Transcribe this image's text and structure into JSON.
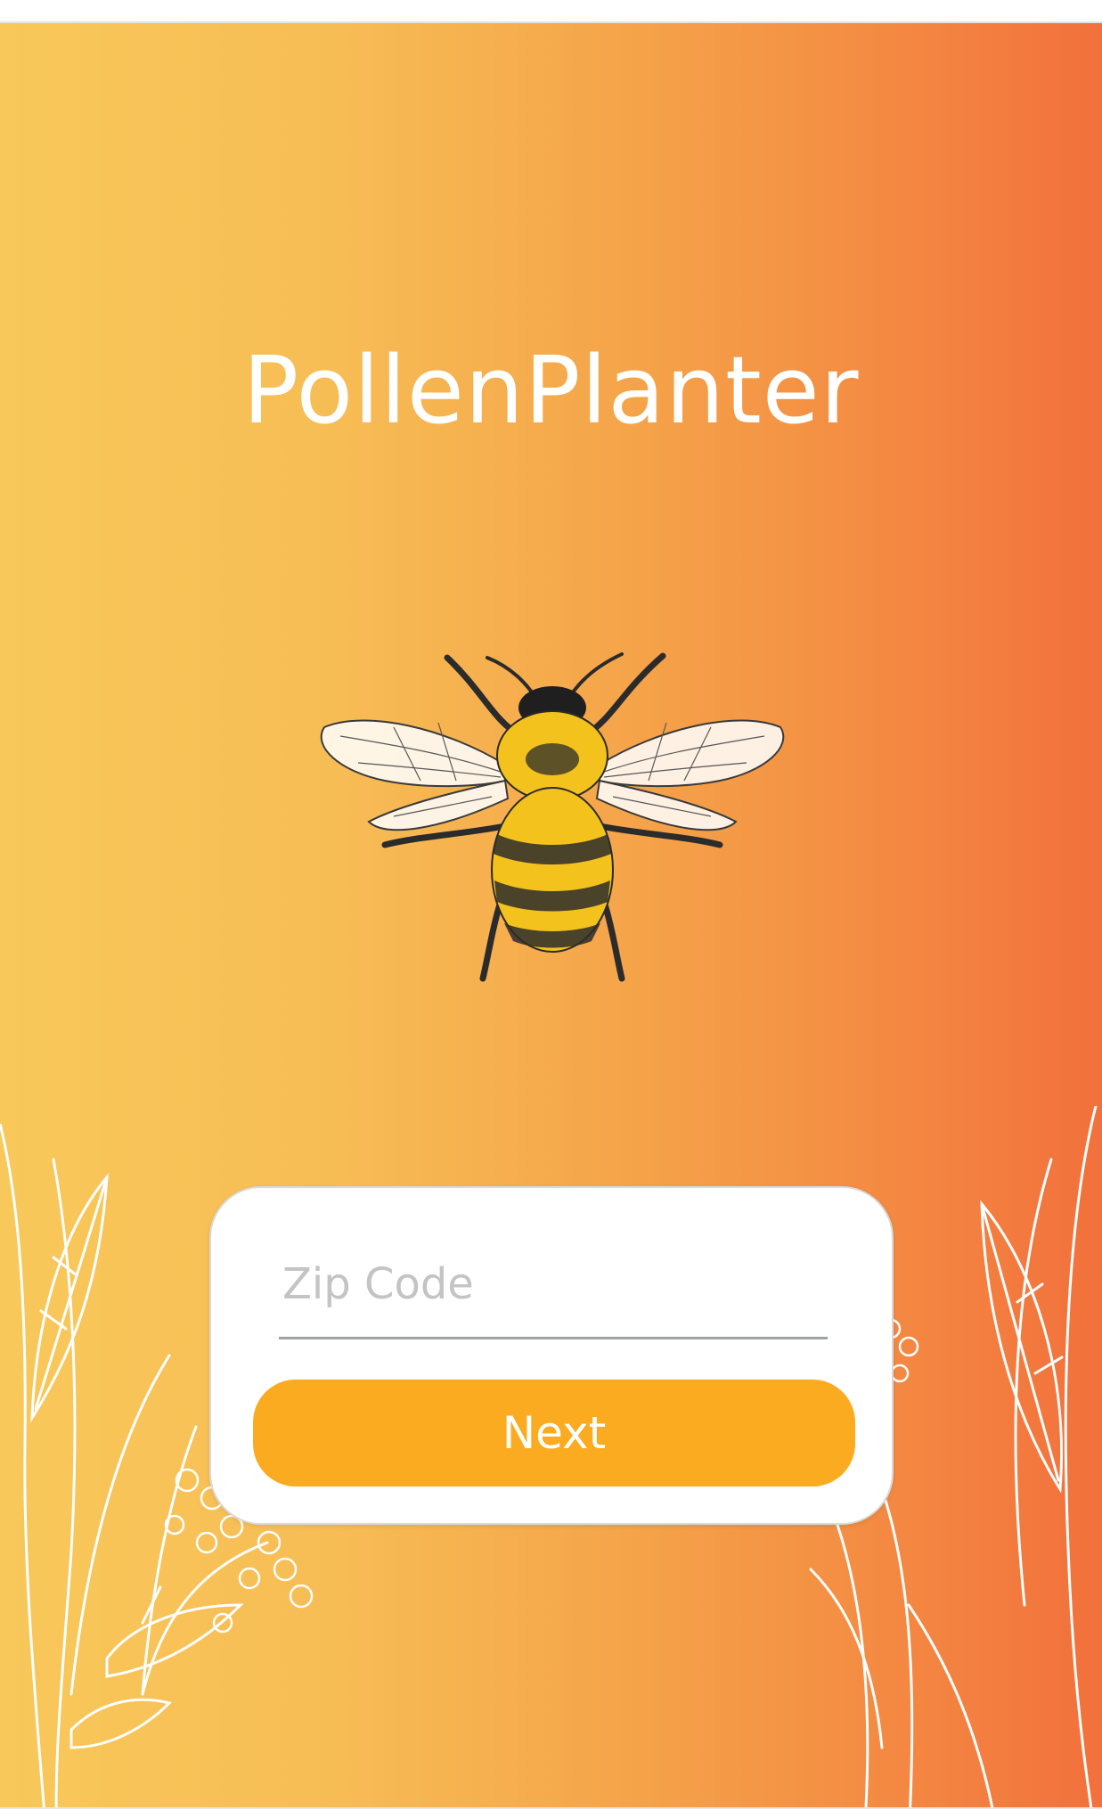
{
  "app": {
    "title": "PollenPlanter"
  },
  "form": {
    "zip": {
      "value": "",
      "placeholder": "Zip Code"
    },
    "next_label": "Next"
  },
  "theme": {
    "gradient_start": "#f8c85a",
    "gradient_end": "#f2703c",
    "button_color": "#fbab20"
  },
  "icons": {
    "hero": "bee-illustration",
    "decoration": "line-art-plants"
  }
}
